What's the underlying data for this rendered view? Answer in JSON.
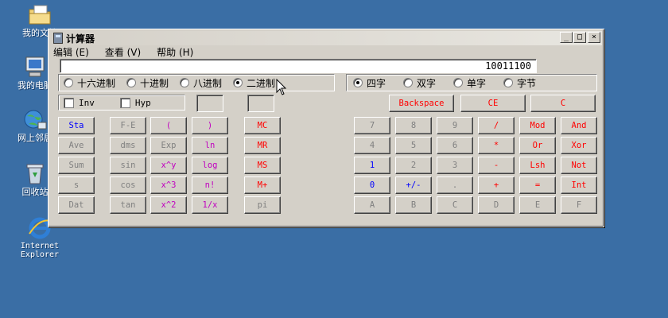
{
  "desktop": {
    "icons": [
      {
        "label": "我的文档"
      },
      {
        "label": "我的电脑"
      },
      {
        "label": "网上邻居"
      },
      {
        "label": "回收站"
      },
      {
        "label": "Internet Explorer"
      }
    ]
  },
  "window": {
    "title": "计算器",
    "controls": {
      "minimize": "_",
      "maximize": "□",
      "close": "×"
    },
    "menu": [
      "编辑 (E)",
      "查看 (V)",
      "帮助 (H)"
    ],
    "display_value": "10011100",
    "base_options": [
      {
        "label": "十六进制",
        "selected": false
      },
      {
        "label": "十进制",
        "selected": false
      },
      {
        "label": "八进制",
        "selected": false
      },
      {
        "label": "二进制",
        "selected": true
      }
    ],
    "word_options": [
      {
        "label": "四字",
        "selected": true
      },
      {
        "label": "双字",
        "selected": false
      },
      {
        "label": "单字",
        "selected": false
      },
      {
        "label": "字节",
        "selected": false
      }
    ],
    "checkboxes": [
      {
        "label": "Inv",
        "checked": false
      },
      {
        "label": "Hyp",
        "checked": false
      }
    ],
    "top_buttons": [
      "Backspace",
      "CE",
      "C"
    ],
    "left_keys": [
      [
        "Sta",
        "F-E",
        "(",
        ")",
        "MC"
      ],
      [
        "Ave",
        "dms",
        "Exp",
        "ln",
        "MR"
      ],
      [
        "Sum",
        "sin",
        "x^y",
        "log",
        "MS"
      ],
      [
        "s",
        "cos",
        "x^3",
        "n!",
        "M+"
      ],
      [
        "Dat",
        "tan",
        "x^2",
        "1/x",
        "pi"
      ]
    ],
    "right_keys": [
      [
        "7",
        "8",
        "9",
        "/",
        "Mod",
        "And"
      ],
      [
        "4",
        "5",
        "6",
        "*",
        "Or",
        "Xor"
      ],
      [
        "1",
        "2",
        "3",
        "-",
        "Lsh",
        "Not"
      ],
      [
        "0",
        "+/-",
        ".",
        "+",
        "=",
        "Int"
      ],
      [
        "A",
        "B",
        "C",
        "D",
        "E",
        "F"
      ]
    ]
  },
  "colors": {
    "desktop": "#3a6ea5",
    "window_face": "#d4d0c8",
    "key_blue": "#0000ff",
    "key_red": "#ff0000",
    "key_magenta": "#c000c0",
    "key_disabled": "#808080"
  }
}
